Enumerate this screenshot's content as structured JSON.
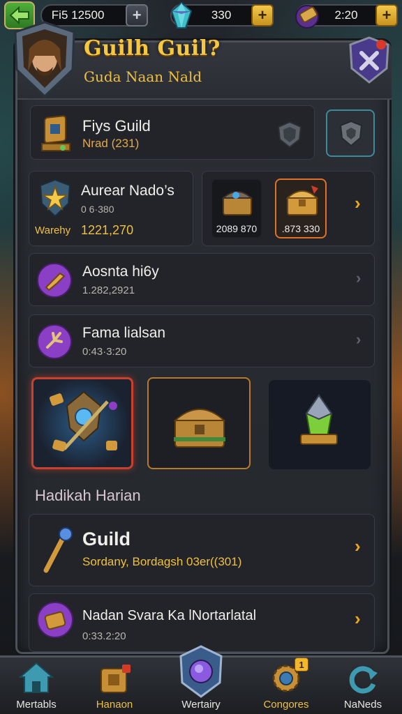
{
  "resources": {
    "gold": "Fi5 12500",
    "gems": "330",
    "energy": "2:20"
  },
  "header": {
    "title": "Guilh Guil?",
    "subtitle": "Guda Naan Nald"
  },
  "guild_card": {
    "title": "Fiys Guild",
    "subtitle": "Nrad (231)"
  },
  "warehouse_card": {
    "title": "Aurear Nado’s",
    "subtitle": "0 6·380",
    "label": "Warehy",
    "value": "1221,270"
  },
  "reward_chests": [
    {
      "value": "2089 870"
    },
    {
      "value": ".873 330"
    }
  ],
  "list_rows": [
    {
      "title": "Aosnta hi6y",
      "subtitle": "1.282,2921"
    },
    {
      "title": "Fama lialsan",
      "subtitle": "0:43·3:20"
    }
  ],
  "section": {
    "label": "Hadikah Harian"
  },
  "quest_rows": [
    {
      "title": "Guild",
      "subtitle": "Sordany, Bordagsh 03er((301)"
    },
    {
      "title": "Nadan Svara Ka lNortarlatal",
      "subtitle": "0:33.2:20"
    }
  ],
  "bottom_nav": [
    {
      "label": "Mertabls"
    },
    {
      "label": "Hanaon",
      "badge": ""
    },
    {
      "label": "Wertairy"
    },
    {
      "label": "Congores",
      "badge": "1"
    },
    {
      "label": "NaNeds"
    }
  ],
  "colors": {
    "accent_gold": "#f0c040",
    "panel_bg": "#222429",
    "purple_icon": "#8b3fc4",
    "teal_highlight": "#3d8a9c"
  }
}
